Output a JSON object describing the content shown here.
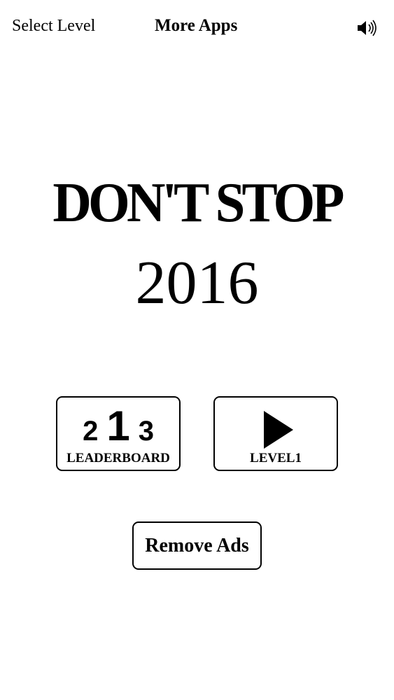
{
  "topbar": {
    "select_level_label": "Select Level",
    "more_apps_label": "More Apps",
    "sound_icon": "speaker-on-icon"
  },
  "title": {
    "main": "DON'T STOP",
    "year": "2016"
  },
  "leaderboard": {
    "ranks": [
      "2",
      "1",
      "3"
    ],
    "label": "LEADERBOARD",
    "icon": "podium-ranks-icon"
  },
  "play": {
    "label": "LEVEL1",
    "icon": "play-icon"
  },
  "remove_ads": {
    "label": "Remove Ads"
  },
  "colors": {
    "background": "#ffffff",
    "foreground": "#000000"
  }
}
